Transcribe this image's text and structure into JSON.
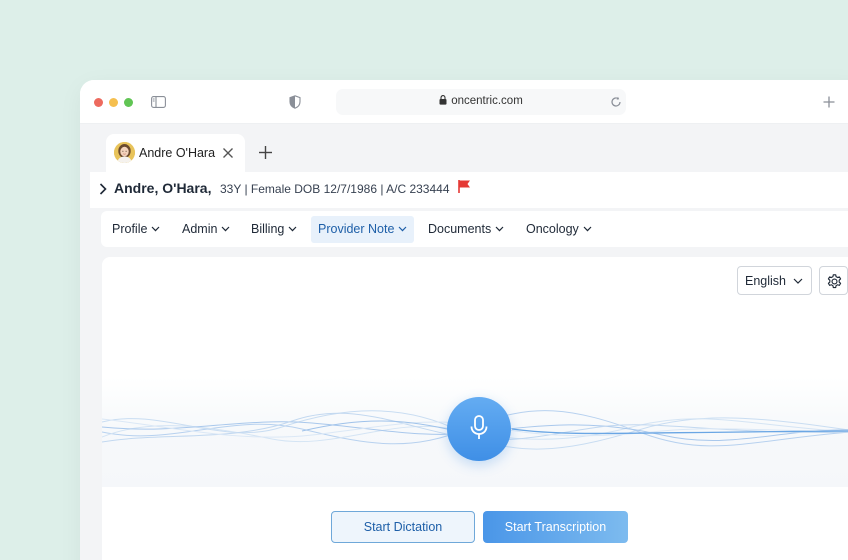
{
  "browser": {
    "url": "oncentric.com"
  },
  "tab": {
    "label": "Andre O'Hara"
  },
  "patient": {
    "name": "Andre, O'Hara,",
    "info": "33Y | Female DOB 12/7/1986 | A/C 233444"
  },
  "nav": {
    "items": [
      {
        "label": "Profile"
      },
      {
        "label": "Admin"
      },
      {
        "label": "Billing"
      },
      {
        "label": "Provider Note"
      },
      {
        "label": "Documents"
      },
      {
        "label": "Oncology"
      }
    ],
    "active": "Provider Note"
  },
  "dictation": {
    "language": "English",
    "start_dictation_label": "Start Dictation",
    "start_transcription_label": "Start Transcription"
  },
  "colors": {
    "background": "#ddefe9",
    "accent": "#3f8fe6",
    "active_nav_bg": "#e8f1fb",
    "active_nav_text": "#1e5fa8",
    "flag": "#e53935"
  },
  "icons": {
    "window_controls": [
      "close-dot",
      "minimize-dot",
      "zoom-dot"
    ],
    "toolbar": [
      "sidebar-icon",
      "shield-icon",
      "lock-icon",
      "reload-icon",
      "plus-icon"
    ],
    "tab": [
      "avatar",
      "close-icon",
      "plus-icon"
    ],
    "patient": [
      "chevron-right-icon",
      "flag-icon"
    ],
    "controls": [
      "chevron-down-icon",
      "gear-icon",
      "microphone-icon"
    ]
  }
}
